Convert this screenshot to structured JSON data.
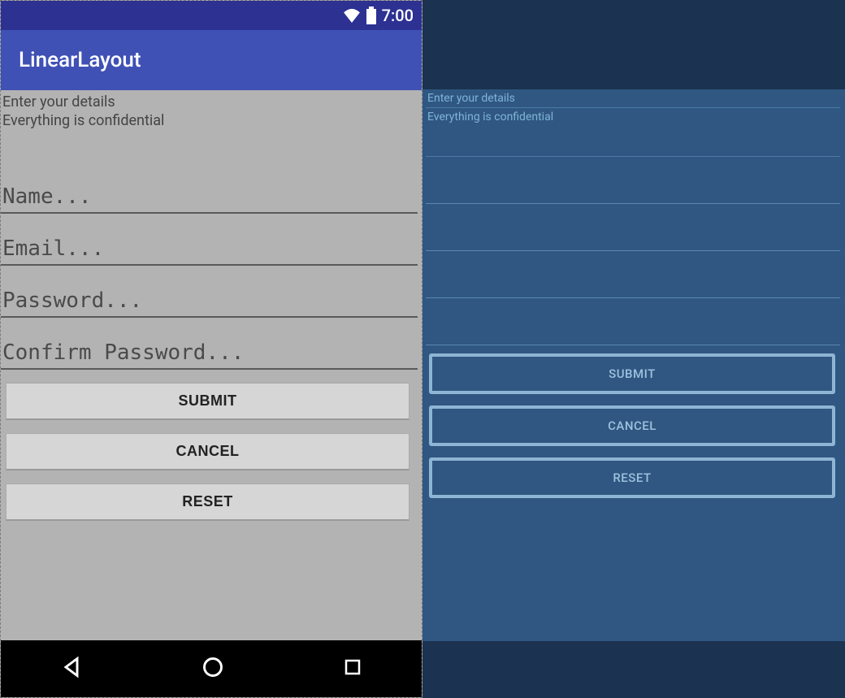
{
  "status": {
    "time": "7:00"
  },
  "appbar": {
    "title": "LinearLayout"
  },
  "form": {
    "line1": "Enter your details",
    "line2": "Everything is confidential",
    "name_hint": "Name...",
    "email_hint": "Email...",
    "password_hint": "Password...",
    "confirm_hint": "Confirm Password..."
  },
  "buttons": {
    "submit": "SUBMIT",
    "cancel": "CANCEL",
    "reset": "RESET"
  },
  "blueprint": {
    "line1": "Enter your details",
    "line2": "Everything is confidential",
    "submit": "SUBMIT",
    "cancel": "CANCEL",
    "reset": "RESET"
  }
}
